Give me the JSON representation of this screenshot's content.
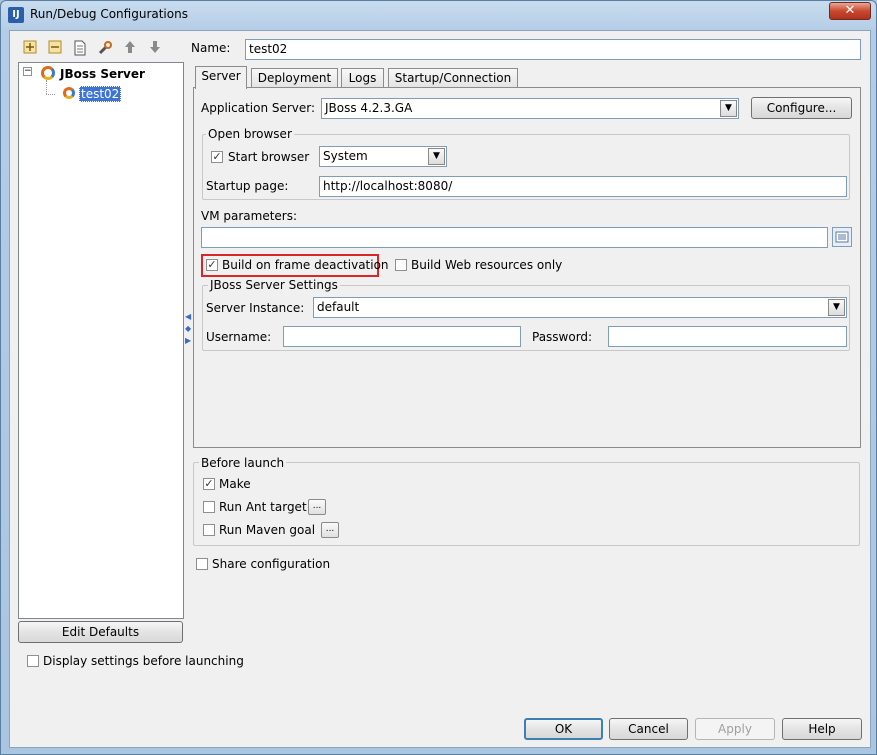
{
  "window": {
    "title": "Run/Debug Configurations",
    "app_icon": "IJ",
    "close_glyph": "✕"
  },
  "toolbar": {
    "icons": [
      "add-icon",
      "remove-icon",
      "copy-icon",
      "wrench-icon",
      "arrow-up-icon",
      "arrow-down-icon"
    ]
  },
  "tree": {
    "root_label": "JBoss Server",
    "child_label": "test02"
  },
  "buttons": {
    "edit_defaults": "Edit Defaults",
    "configure": "Configure...",
    "ok": "OK",
    "cancel": "Cancel",
    "apply": "Apply",
    "help": "Help",
    "ellipsis": "..."
  },
  "name": {
    "label": "Name:",
    "value": "test02"
  },
  "tabs": [
    "Server",
    "Deployment",
    "Logs",
    "Startup/Connection"
  ],
  "server_tab": {
    "app_server_label": "Application Server:",
    "app_server_value": "JBoss 4.2.3.GA",
    "open_browser_title": "Open browser",
    "start_browser_label": "Start browser",
    "start_browser_checked": true,
    "browser_value": "System",
    "startup_page_label": "Startup page:",
    "startup_page_value": "http://localhost:8080/",
    "vm_params_label": "VM parameters:",
    "vm_params_value": "",
    "build_on_deactivation_label": "Build on frame deactivation",
    "build_on_deactivation_checked": true,
    "build_web_only_label": "Build Web resources only",
    "build_web_only_checked": false,
    "jboss_settings_title": "JBoss Server Settings",
    "server_instance_label": "Server Instance:",
    "server_instance_value": "default",
    "username_label": "Username:",
    "username_value": "",
    "password_label": "Password:",
    "password_value": ""
  },
  "before_launch": {
    "title": "Before launch",
    "make_label": "Make",
    "make_checked": true,
    "ant_label": "Run Ant target",
    "ant_checked": false,
    "maven_label": "Run Maven goal",
    "maven_checked": false
  },
  "share_configuration_label": "Share configuration",
  "display_settings_label": "Display settings before launching",
  "colors": {
    "highlight_border": "#d8262a",
    "selection": "#3b74d8"
  }
}
